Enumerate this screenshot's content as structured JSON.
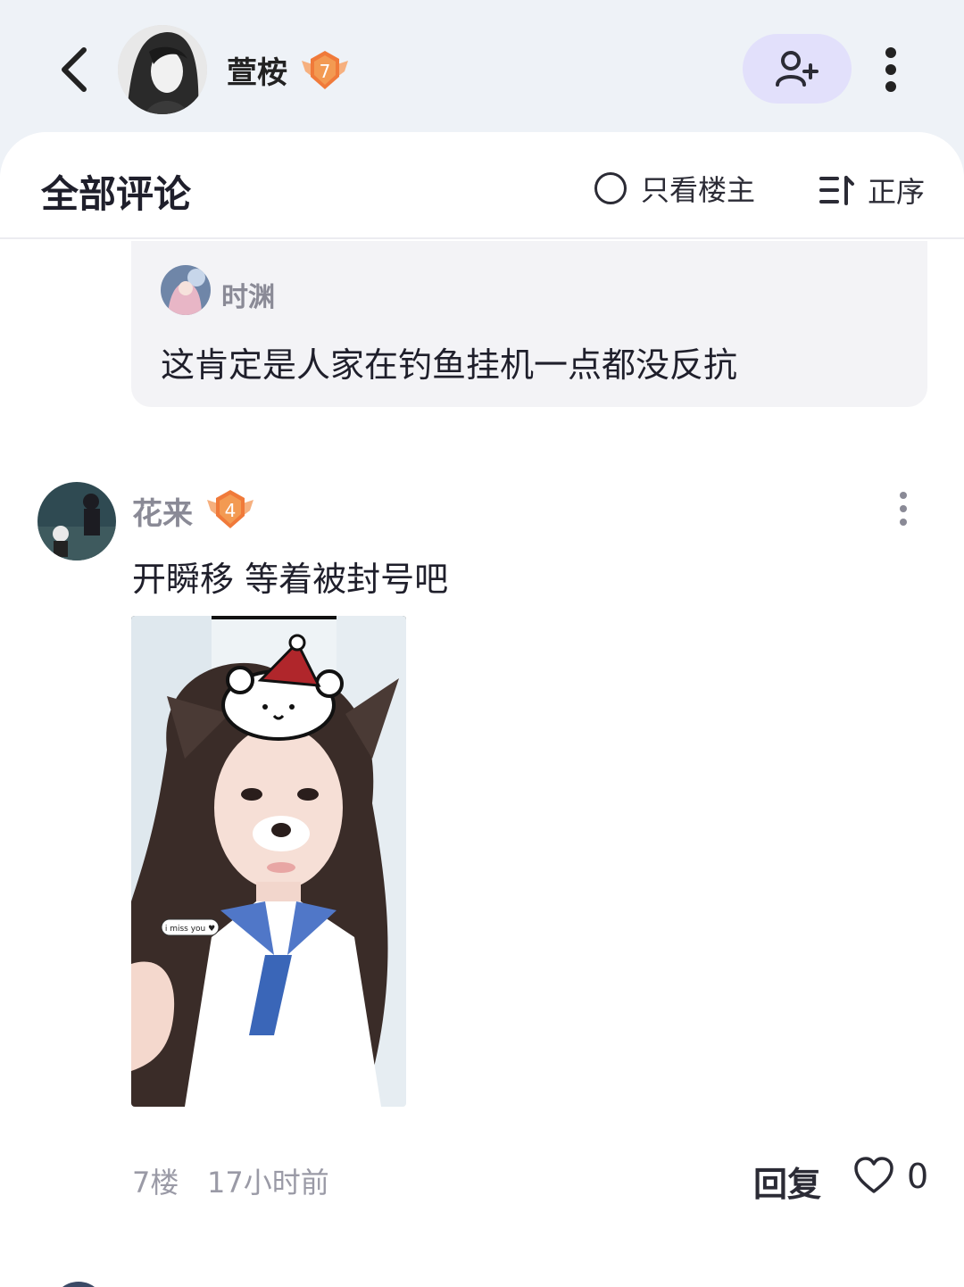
{
  "header": {
    "author_name": "萱桉",
    "author_level": "7",
    "back_icon": "back-arrow-icon",
    "follow_icon": "add-user-icon",
    "more_icon": "more-vertical-icon"
  },
  "comments_section": {
    "title": "全部评论",
    "only_owner_label": "只看楼主",
    "sort_label": "正序"
  },
  "quoted_reply": {
    "name": "时渊",
    "text": "这肯定是人家在钓鱼挂机一点都没反抗"
  },
  "comment": {
    "name": "花来",
    "level": "4",
    "text": "开瞬移 等着被封号吧",
    "image_caption": "i miss you ♥",
    "floor": "7楼",
    "time": "17小时前",
    "reply_label": "回复",
    "like_count": "0"
  },
  "colors": {
    "accent_bg": "#e2e0fb",
    "badge": "#f07a3a",
    "muted_text": "#8a8a96"
  }
}
